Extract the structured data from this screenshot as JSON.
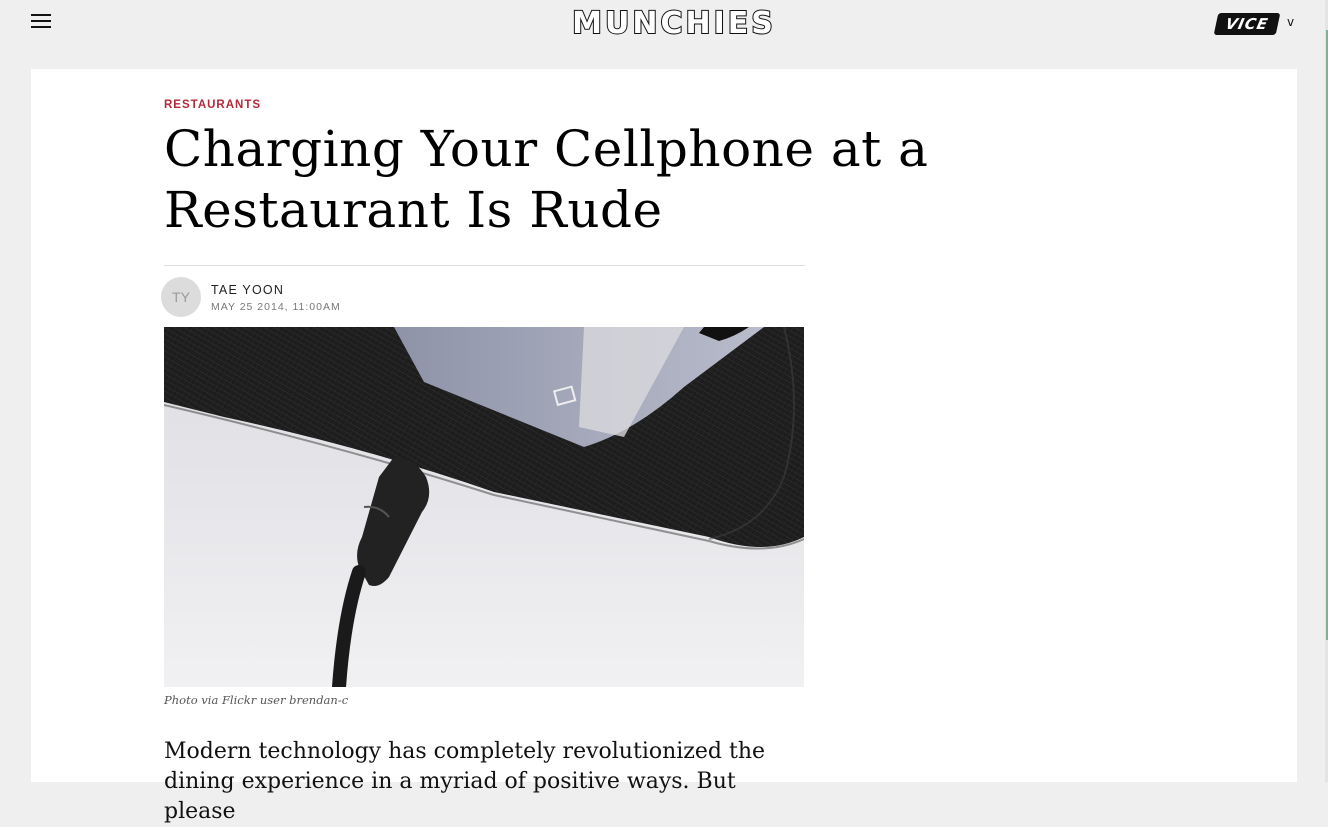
{
  "header": {
    "logo": "MUNCHIES",
    "network_logo": "VICE",
    "network_chevron": "v"
  },
  "article": {
    "section": "RESTAURANTS",
    "title": "Charging Your Cellphone at a Restaurant Is Rude",
    "author_initials": "TY",
    "author": "TAE YOON",
    "date": "MAY 25 2014, 11:00AM",
    "image_caption": "Photo via Flickr user brendan-c",
    "body": "Modern technology has completely revolutionized the dining experience in a myriad of positive ways. But please"
  },
  "icons": [
    "hamburger-menu-icon",
    "chevron-down-icon"
  ],
  "colors": {
    "accent": "#b22a3b",
    "page_bg": "#efefef",
    "card_bg": "#ffffff"
  }
}
